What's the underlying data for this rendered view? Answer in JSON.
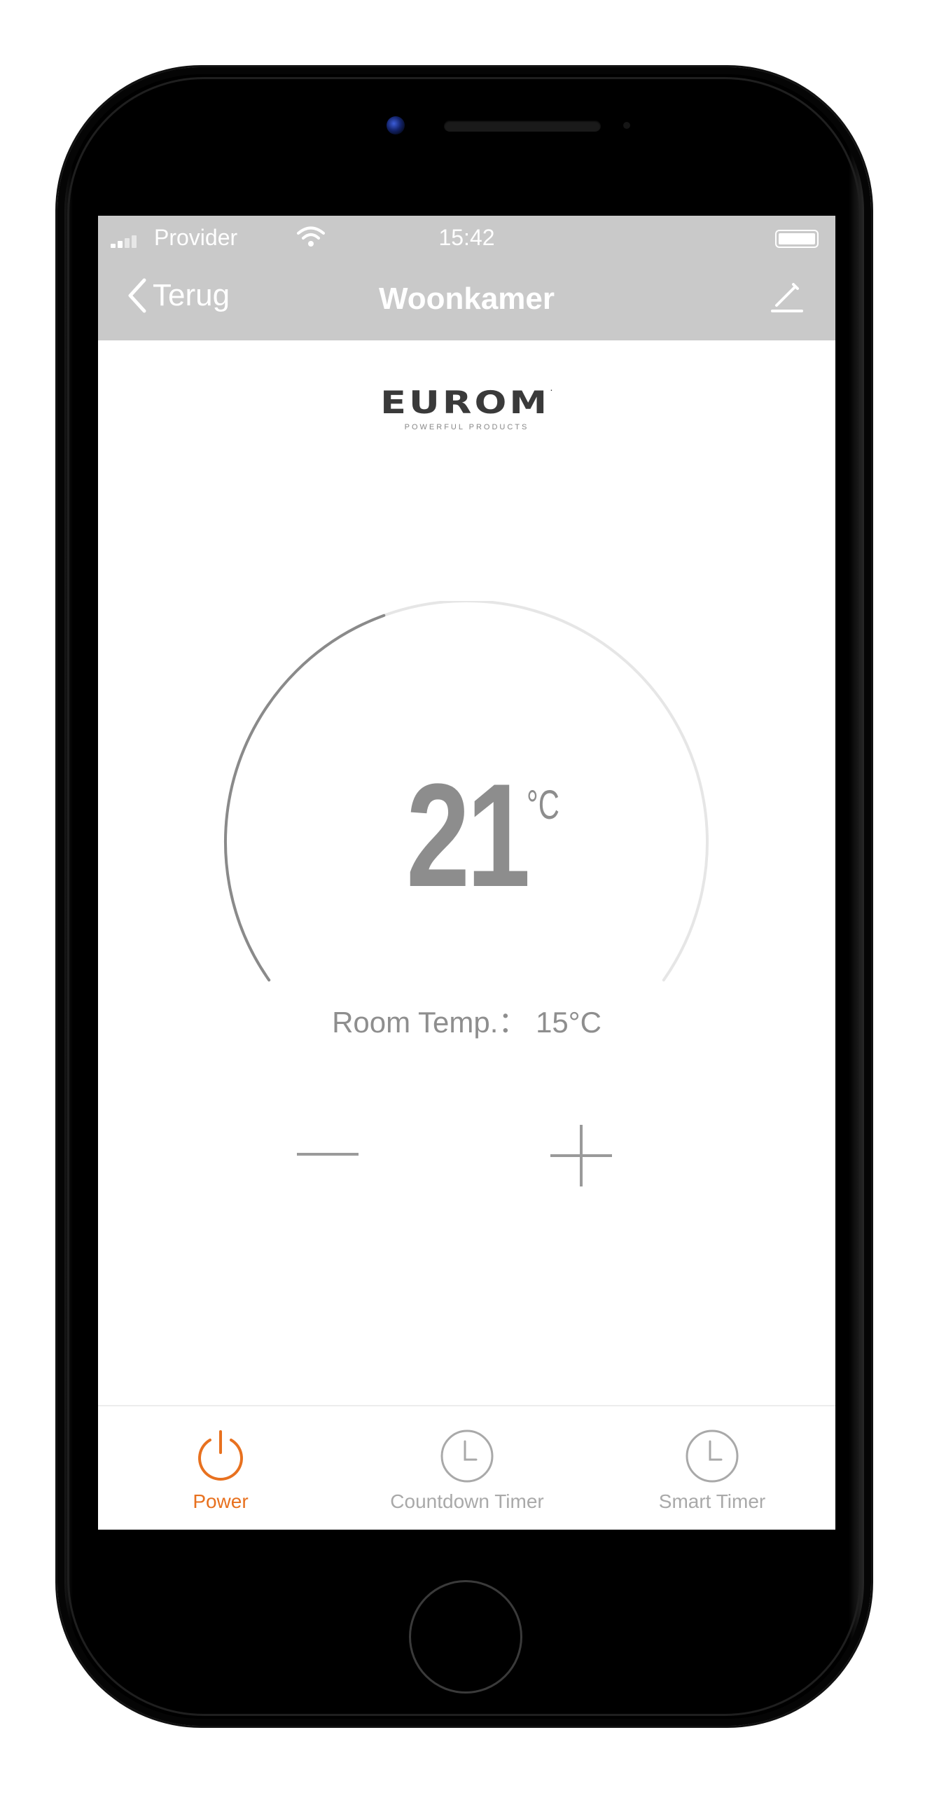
{
  "status_bar": {
    "carrier": "Provider",
    "time": "15:42"
  },
  "nav": {
    "back_label": "Terug",
    "title": "Woonkamer",
    "back_icon": "chevron-left-icon",
    "edit_icon": "pencil-icon"
  },
  "brand": {
    "logo_text": "EUROM",
    "tagline": "POWERFUL PRODUCTS"
  },
  "thermostat": {
    "set_temperature": "21",
    "unit": "°C",
    "room_temp_label": "Room Temp.： 15°C",
    "dial_fill_fraction": 0.42,
    "minus_icon": "minus-icon",
    "plus_icon": "plus-icon"
  },
  "tabs": [
    {
      "label": "Power",
      "icon": "power-icon",
      "active": true
    },
    {
      "label": "Countdown Timer",
      "icon": "clock-icon",
      "active": false
    },
    {
      "label": "Smart Timer",
      "icon": "clock-icon",
      "active": false
    }
  ],
  "colors": {
    "accent": "#e8711f",
    "header_gray": "#c9c9c9",
    "dial_dark": "#8a8a8a",
    "dial_light": "#e6e6e6",
    "text_gray": "#8e8e8e"
  }
}
